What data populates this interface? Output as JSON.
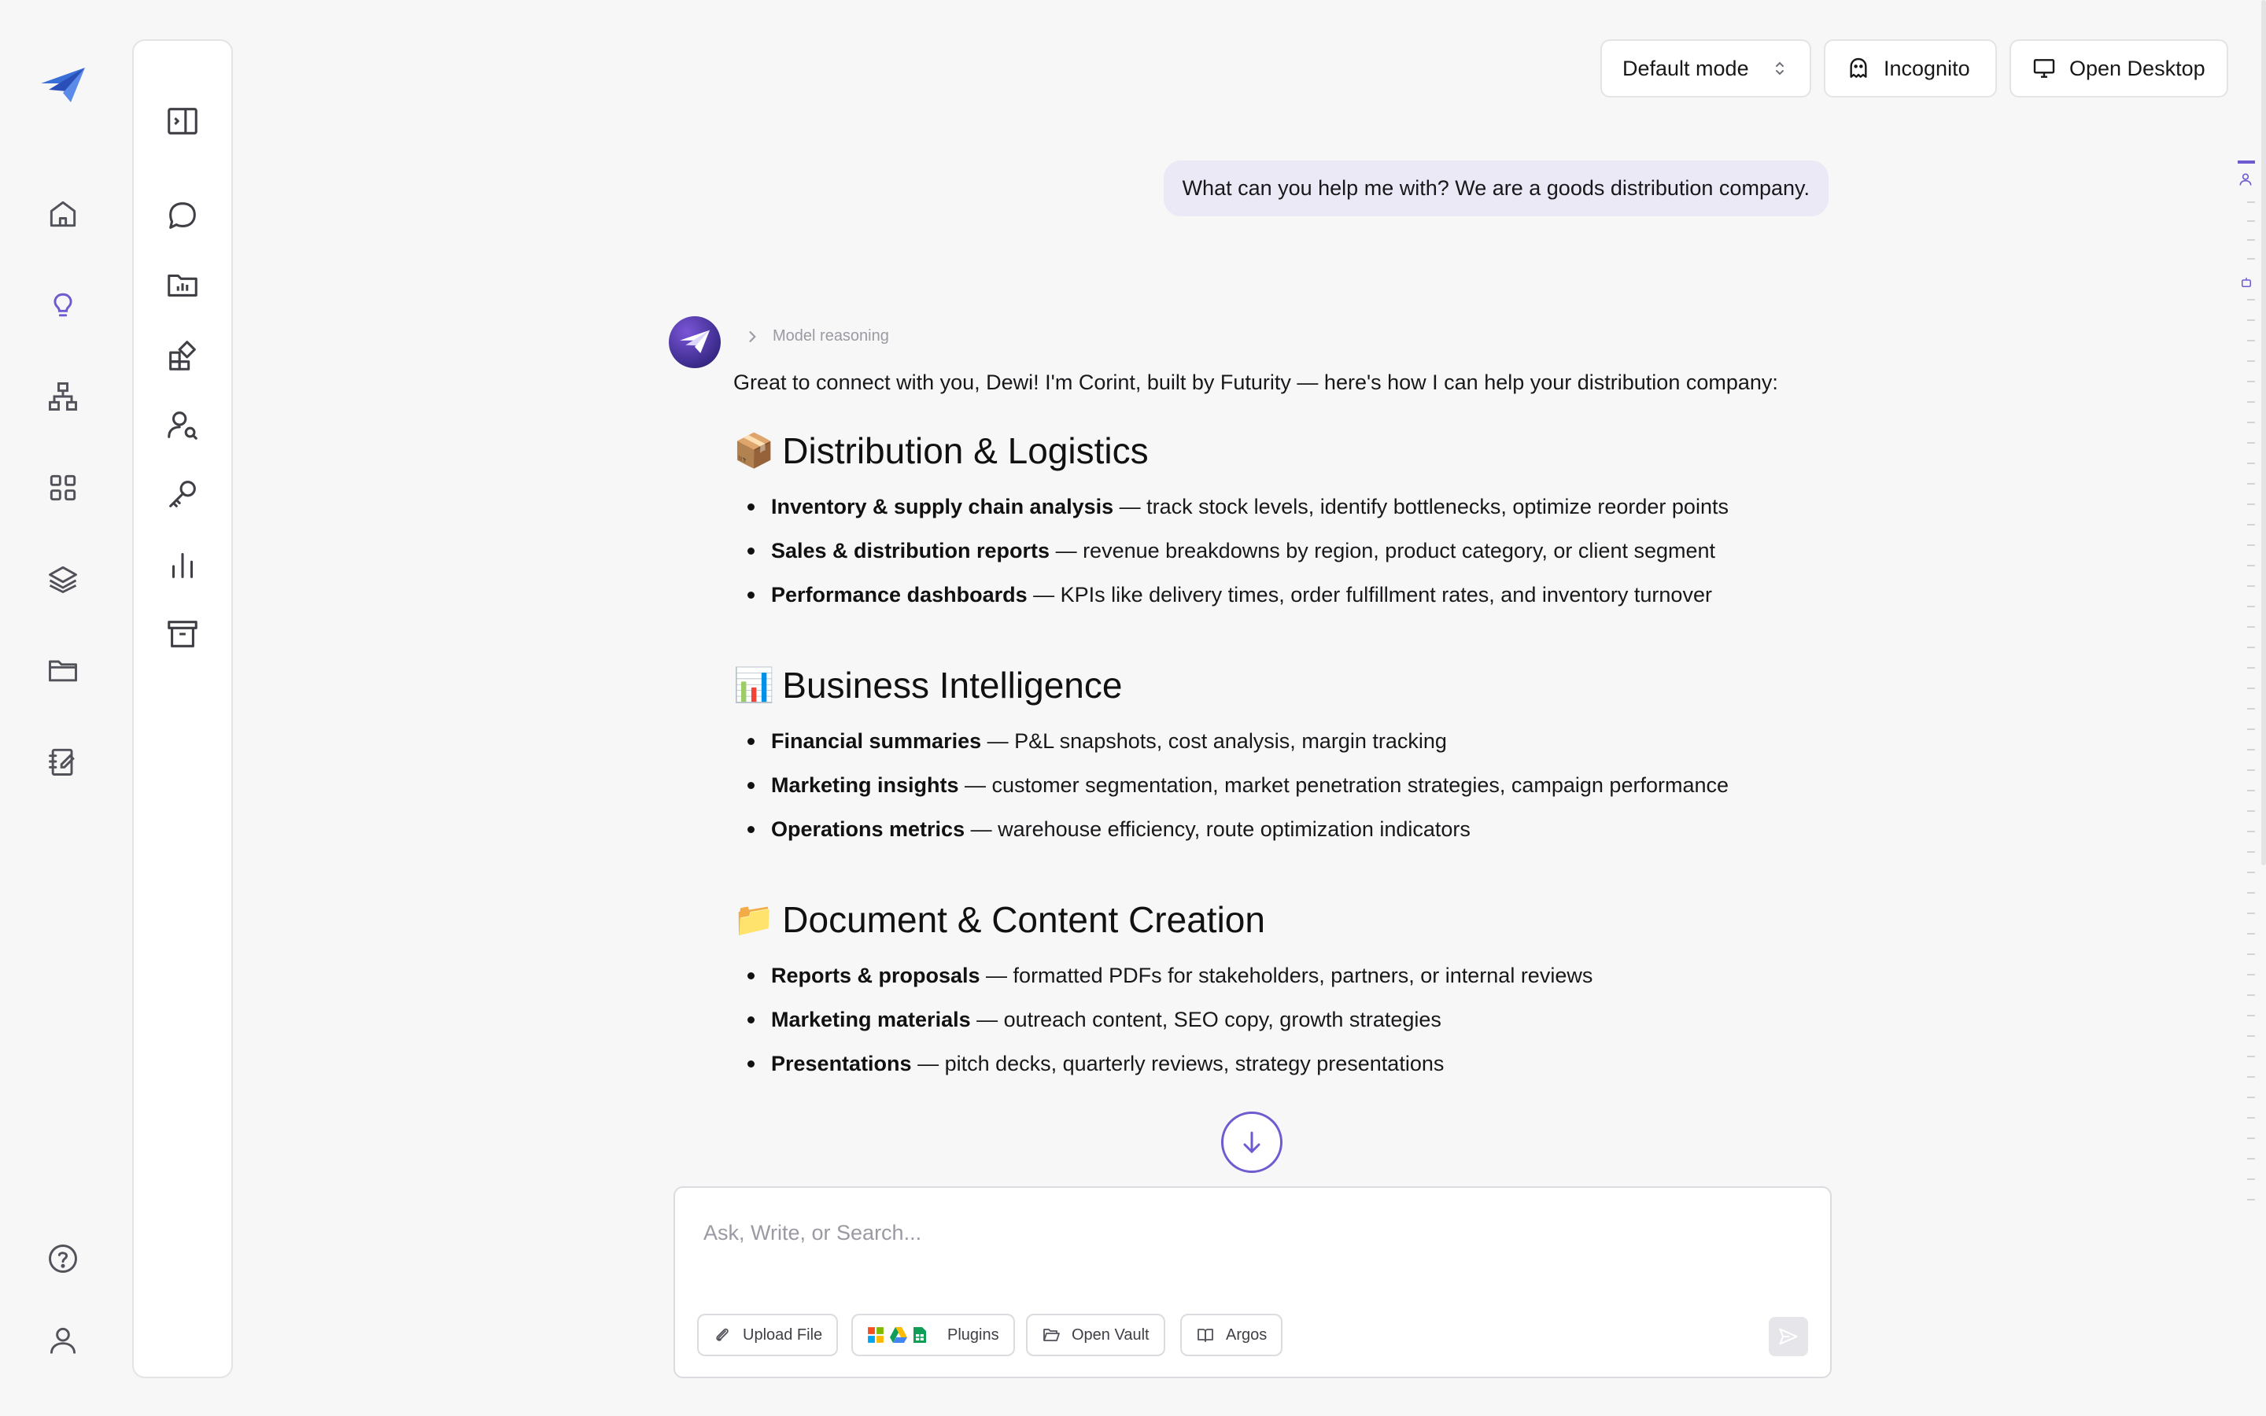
{
  "topbar": {
    "mode_label": "Default mode",
    "incognito_label": "Incognito",
    "open_desktop_label": "Open Desktop"
  },
  "user_message": "What can you help me with? We are a goods distribution company.",
  "assistant": {
    "reasoning_label": "Model reasoning",
    "intro": "Great to connect with you, Dewi! I'm Corint, built by Futurity — here's how I can help your distribution company:",
    "sections": [
      {
        "emoji": "📦",
        "title": "Distribution & Logistics",
        "items": [
          {
            "bold": "Inventory & supply chain analysis",
            "text": " — track stock levels, identify bottlenecks, optimize reorder points"
          },
          {
            "bold": "Sales & distribution reports",
            "text": " — revenue breakdowns by region, product category, or client segment"
          },
          {
            "bold": "Performance dashboards",
            "text": " — KPIs like delivery times, order fulfillment rates, and inventory turnover"
          }
        ]
      },
      {
        "emoji": "📊",
        "title": "Business Intelligence",
        "items": [
          {
            "bold": "Financial summaries",
            "text": " — P&L snapshots, cost analysis, margin tracking"
          },
          {
            "bold": "Marketing insights",
            "text": " — customer segmentation, market penetration strategies, campaign performance"
          },
          {
            "bold": "Operations metrics",
            "text": " — warehouse efficiency, route optimization indicators"
          }
        ]
      },
      {
        "emoji": "📁",
        "title": "Document & Content Creation",
        "items": [
          {
            "bold": "Reports & proposals",
            "text": " — formatted PDFs for stakeholders, partners, or internal reviews"
          },
          {
            "bold": "Marketing materials",
            "text": " — outreach content, SEO copy, growth strategies"
          },
          {
            "bold": "Presentations",
            "text": " — pitch decks, quarterly reviews, strategy presentations"
          }
        ]
      }
    ]
  },
  "composer": {
    "placeholder": "Ask, Write, or Search...",
    "upload_label": "Upload File",
    "plugins_label": "Plugins",
    "vault_label": "Open Vault",
    "argos_label": "Argos"
  },
  "colors": {
    "accent": "#6f5bd0",
    "background": "#f7f7f8",
    "user_bubble": "#ece9f7"
  },
  "icons": {
    "rail": [
      "logo",
      "home-icon",
      "lightbulb-icon",
      "org-chart-icon",
      "grid-icon",
      "layers-icon",
      "folder-icon",
      "notebook-icon",
      "help-icon",
      "user-icon"
    ],
    "panel": [
      "sidebar-toggle-icon",
      "chat-icon",
      "folder-chart-icon",
      "widgets-icon",
      "user-search-icon",
      "key-icon",
      "bar-chart-icon",
      "archive-icon"
    ]
  }
}
